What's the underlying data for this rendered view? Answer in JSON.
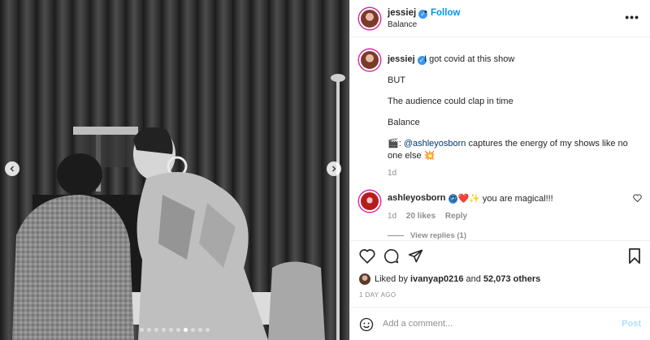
{
  "post": {
    "username": "jessiej",
    "follow_label": "Follow",
    "separator": "•",
    "location": "Balance",
    "more": "•••"
  },
  "caption": {
    "username": "jessiej",
    "first_line": "I got covid at this show",
    "lines": [
      "BUT",
      "The audience could clap in time",
      "Balance"
    ],
    "credit_prefix": "🎬: ",
    "credit_mention": "@ashleyosborn",
    "credit_rest": " captures the energy of my shows like no one else 💥",
    "age": "1d"
  },
  "comment": {
    "username": "ashleyosborn",
    "text": "😍❤️✨ you are magical!!!",
    "age": "1d",
    "likes": "20 likes",
    "reply_label": "Reply",
    "view_replies": "View replies (1)"
  },
  "likes": {
    "prefix": "Liked by ",
    "user": "ivanyap0216",
    "middle": " and ",
    "count": "52,073 others"
  },
  "date": "1 DAY AGO",
  "add_comment": {
    "placeholder": "Add a comment...",
    "post_label": "Post"
  },
  "media": {
    "slide_count": 10,
    "active_slide": 6
  },
  "colors": {
    "follow_blue": "#0095f6",
    "verified_blue": "#3897f0",
    "muted_text": "#8e8e8e",
    "post_disabled": "#b2dffc",
    "border": "#efefef"
  },
  "icons": [
    "chevron-left-icon",
    "chevron-right-icon",
    "verified-icon",
    "heart-icon",
    "comment-icon",
    "share-icon",
    "bookmark-icon",
    "emoji-icon",
    "more-icon"
  ]
}
